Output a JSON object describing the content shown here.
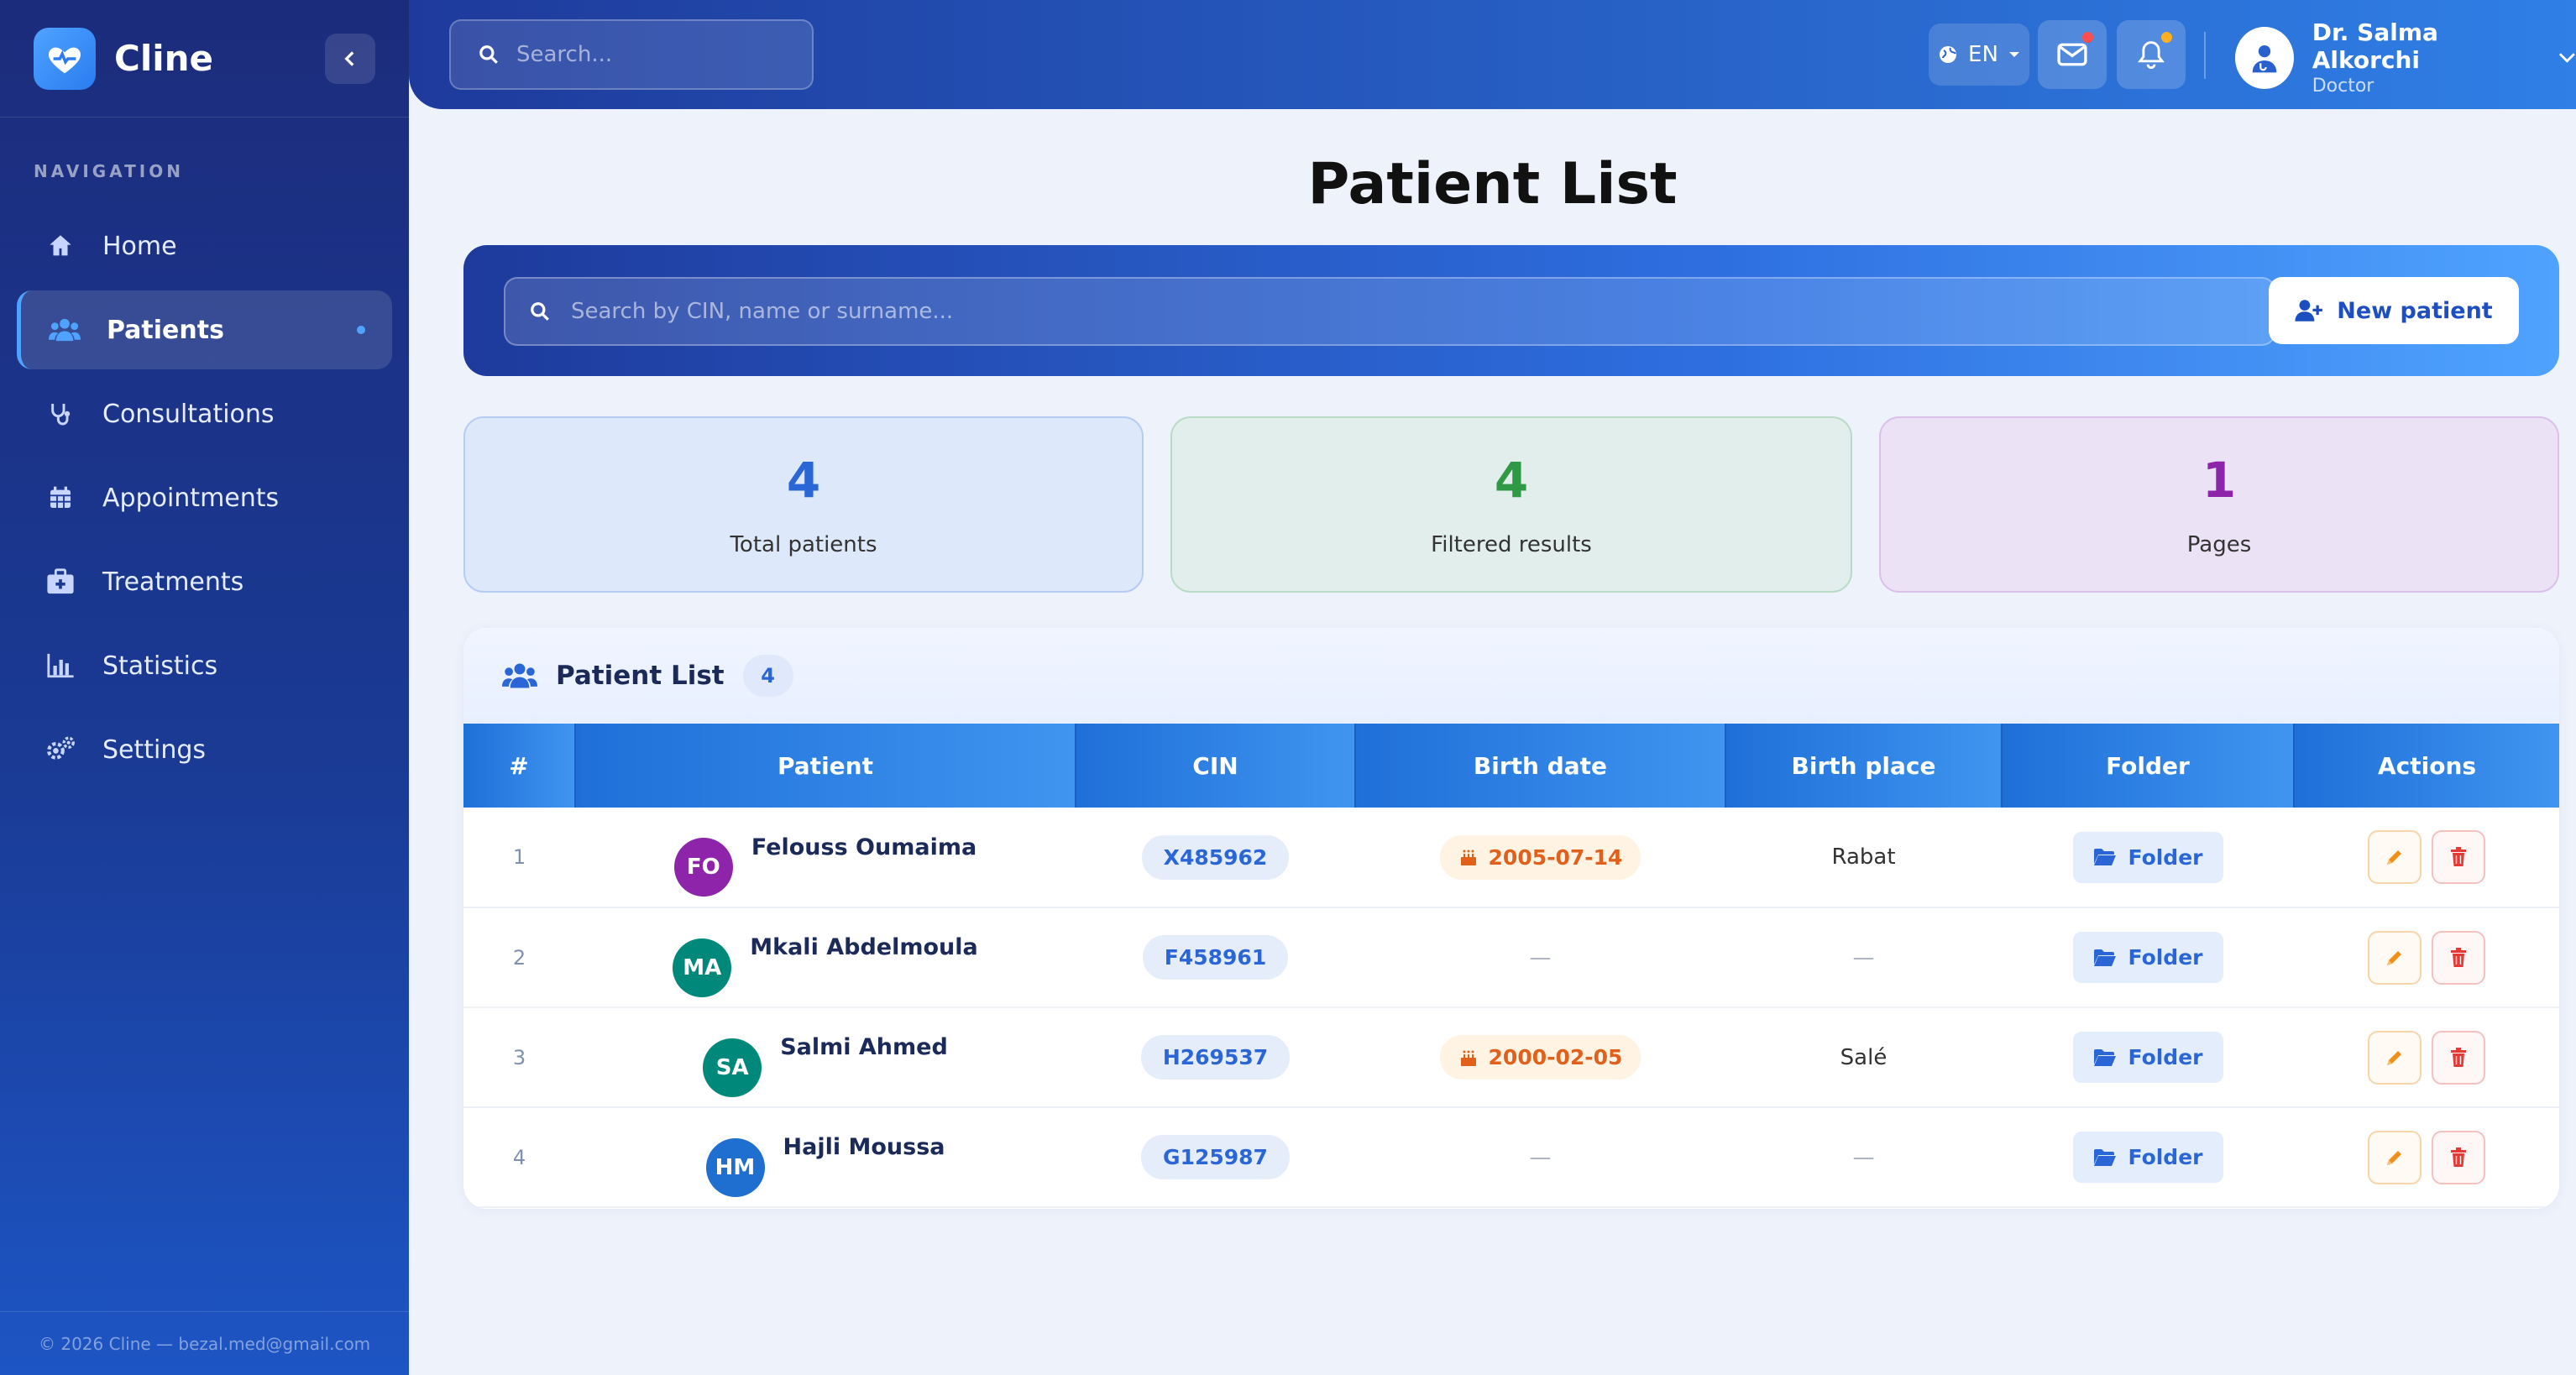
{
  "sidebar": {
    "brand": "Cline",
    "nav_heading": "NAVIGATION",
    "items": [
      {
        "label": "Home",
        "icon": "home-icon"
      },
      {
        "label": "Patients",
        "icon": "users-icon",
        "active": true
      },
      {
        "label": "Consultations",
        "icon": "stethoscope-icon"
      },
      {
        "label": "Appointments",
        "icon": "calendar-icon"
      },
      {
        "label": "Treatments",
        "icon": "medkit-icon"
      },
      {
        "label": "Statistics",
        "icon": "bar-chart-icon"
      },
      {
        "label": "Settings",
        "icon": "gears-icon"
      }
    ],
    "footer": "© 2026 Cline — bezal.med@gmail.com"
  },
  "topbar": {
    "search_placeholder": "Search...",
    "language": "EN",
    "user_name": "Dr. Salma Alkorchi",
    "user_role": "Doctor"
  },
  "page": {
    "title": "Patient List",
    "search_placeholder": "Search by CIN, name or surname...",
    "new_button": "New patient"
  },
  "stats": [
    {
      "value": "4",
      "label": "Total patients",
      "color": "#2a66d6"
    },
    {
      "value": "4",
      "label": "Filtered results",
      "color": "#2e9a46"
    },
    {
      "value": "1",
      "label": "Pages",
      "color": "#8e24aa"
    }
  ],
  "table": {
    "title": "Patient List",
    "count": "4",
    "columns": [
      "#",
      "Patient",
      "CIN",
      "Birth date",
      "Birth place",
      "Folder",
      "Actions"
    ],
    "folder_label": "Folder",
    "rows": [
      {
        "num": "1",
        "initials": "FO",
        "name": "Felouss Oumaima",
        "cin": "X485962",
        "birth_date": "2005-07-14",
        "birth_place": "Rabat",
        "avatar_color": "#8e24aa"
      },
      {
        "num": "2",
        "initials": "MA",
        "name": "Mkali Abdelmoula",
        "cin": "F458961",
        "birth_date": "—",
        "birth_place": "—",
        "avatar_color": "#00897b"
      },
      {
        "num": "3",
        "initials": "SA",
        "name": "Salmi Ahmed",
        "cin": "H269537",
        "birth_date": "2000-02-05",
        "birth_place": "Salé",
        "avatar_color": "#00897b"
      },
      {
        "num": "4",
        "initials": "HM",
        "name": "Hajli Moussa",
        "cin": "G125987",
        "birth_date": "—",
        "birth_place": "—",
        "avatar_color": "#1e6fd0"
      }
    ]
  }
}
